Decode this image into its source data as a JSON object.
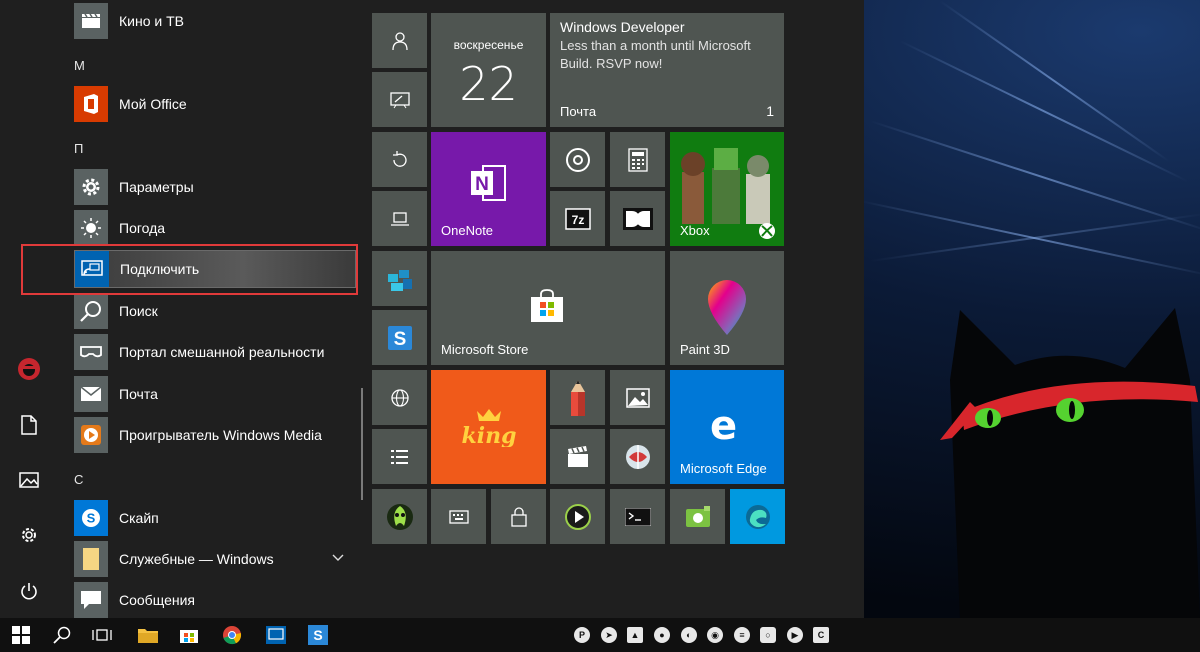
{
  "start_menu": {
    "apps": [
      {
        "label": "Кино и ТВ",
        "icon": "film-icon"
      },
      {
        "label": "Мой Office",
        "icon": "office-icon"
      },
      {
        "label": "Параметры",
        "icon": "gear-icon"
      },
      {
        "label": "Погода",
        "icon": "sun-icon"
      },
      {
        "label": "Подключить",
        "icon": "connect-icon"
      },
      {
        "label": "Поиск",
        "icon": "search-icon"
      },
      {
        "label": "Портал смешанной реальности",
        "icon": "vr-headset-icon"
      },
      {
        "label": "Почта",
        "icon": "mail-icon"
      },
      {
        "label": "Проигрыватель Windows Media",
        "icon": "media-player-icon"
      },
      {
        "label": "Скайп",
        "icon": "skype-icon"
      },
      {
        "label": "Служебные — Windows",
        "icon": "folder-icon"
      },
      {
        "label": "Сообщения",
        "icon": "message-icon"
      }
    ],
    "groups": [
      "М",
      "П",
      "С"
    ],
    "selected_app": "Подключить"
  },
  "tiles": {
    "calendar": {
      "day": "воскресенье",
      "date": "22"
    },
    "mail": {
      "title": "Windows Developer",
      "body": "Less than a month until Microsoft Build. RSVP now!",
      "label": "Почта",
      "count": "1"
    },
    "onenote": "OneNote",
    "xbox": "Xbox",
    "store": "Microsoft Store",
    "paint3d": "Paint 3D",
    "edge": "Microsoft Edge"
  },
  "colors": {
    "menu_bg": "#1f1f1f",
    "tile_bg": "#4f5551",
    "accent_blue": "#0078d7",
    "onenote": "#7719aa",
    "xbox": "#107c10",
    "king": "#f05a1a",
    "highlight_border": "#e03a3a"
  }
}
